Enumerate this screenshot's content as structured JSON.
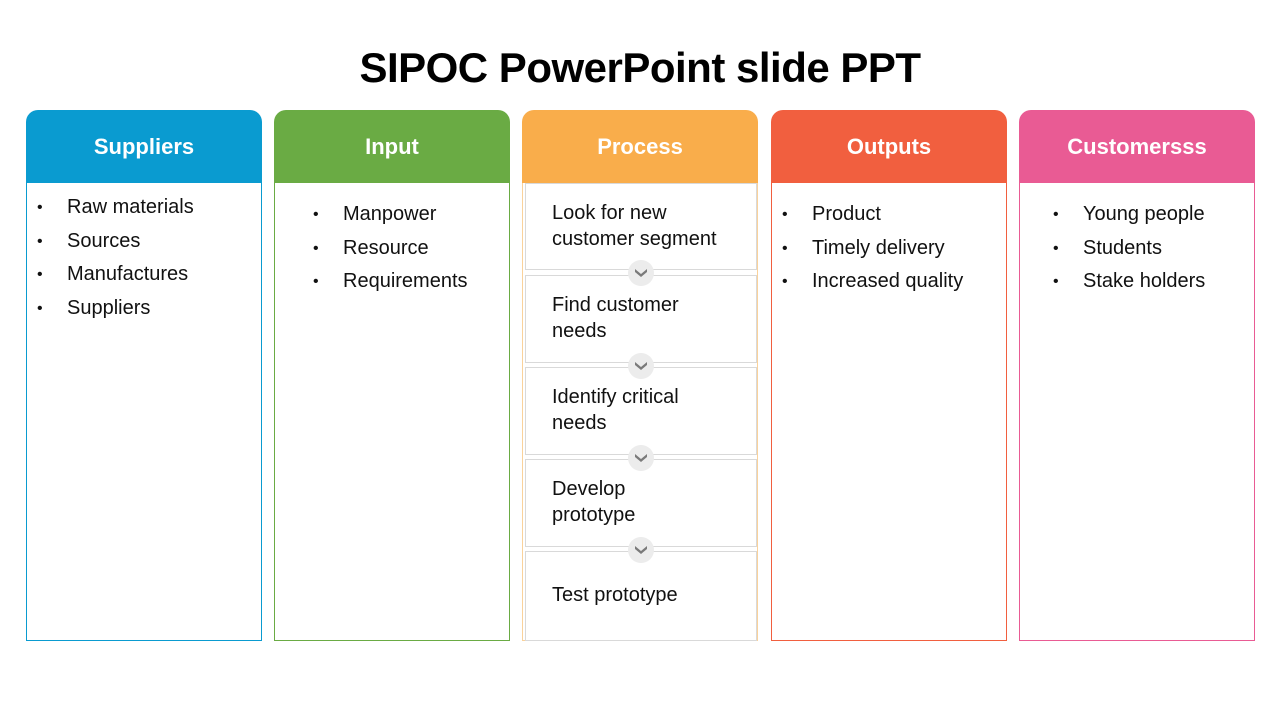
{
  "title": "SIPOC PowerPoint slide PPT",
  "columns": [
    {
      "key": "suppliers",
      "header": "Suppliers",
      "color": "#0A9BD0",
      "items": [
        "Raw materials",
        "Sources",
        "Manufactures",
        "Suppliers"
      ]
    },
    {
      "key": "input",
      "header": "Input",
      "color": "#6AAB44",
      "items": [
        "Manpower",
        "Resource",
        "Requirements"
      ]
    },
    {
      "key": "process",
      "header": "Process",
      "color": "#F9AD4B",
      "steps": [
        [
          "Look for new",
          "customer segment"
        ],
        [
          "Find customer",
          "needs"
        ],
        [
          "Identify critical",
          "needs"
        ],
        [
          "Develop",
          "prototype"
        ],
        [
          "Test prototype"
        ]
      ]
    },
    {
      "key": "outputs",
      "header": "Outputs",
      "color": "#F15F3F",
      "items": [
        "Product",
        "Timely delivery",
        "Increased quality"
      ]
    },
    {
      "key": "customers",
      "header": "Customersss",
      "color": "#E95B94",
      "items": [
        "Young people",
        "Students",
        "Stake holders"
      ]
    }
  ],
  "icons": {
    "bullet": "•",
    "step_connector": "chevron-down-icon"
  }
}
